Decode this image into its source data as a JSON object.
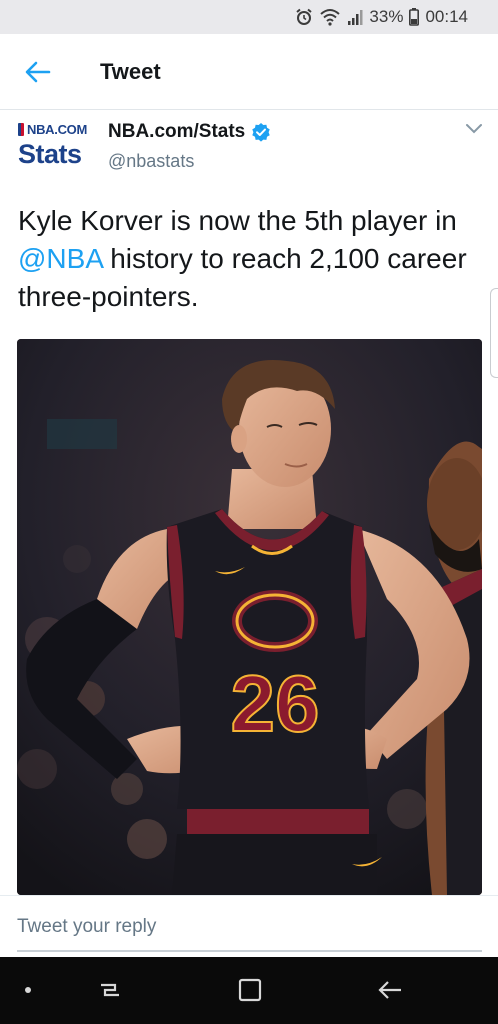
{
  "status_bar": {
    "battery": "33%",
    "time": "00:14"
  },
  "header": {
    "title": "Tweet"
  },
  "tweet": {
    "avatar_logo_top": "NBA.COM",
    "avatar_logo_bottom": "Stats",
    "display_name": "NBA.com/Stats",
    "handle": "@nbastats",
    "verified": true,
    "text_before": "Kyle Korver is now the 5th player in ",
    "mention": "@NBA",
    "text_after": " history to reach 2,100 career three-pointers.",
    "media": {
      "jersey_number": "26"
    }
  },
  "reply": {
    "placeholder": "Tweet your reply"
  },
  "colors": {
    "accent": "#1da1f2",
    "nba_blue": "#1d428a",
    "nba_red": "#c8102e",
    "cavs_wine": "#8b1a2e",
    "cavs_gold": "#f5b335"
  },
  "icons": {
    "back": "arrow-left-icon",
    "verified": "verified-badge-icon",
    "menu": "chevron-down-icon",
    "alarm": "alarm-icon",
    "wifi": "wifi-icon",
    "signal": "signal-icon",
    "battery": "battery-icon"
  }
}
